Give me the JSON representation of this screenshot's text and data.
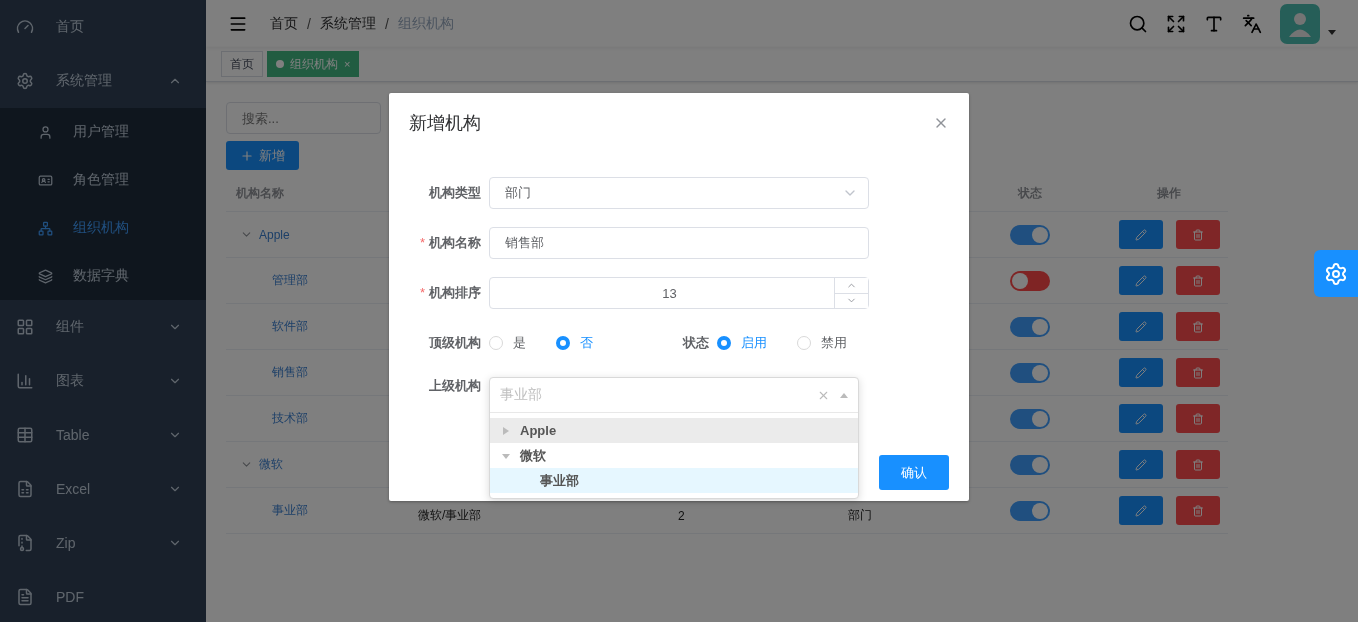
{
  "sidebar": {
    "items": [
      {
        "label": "首页"
      },
      {
        "label": "系统管理",
        "expanded": true,
        "children": [
          {
            "label": "用户管理",
            "selected": false
          },
          {
            "label": "角色管理",
            "selected": false
          },
          {
            "label": "组织机构",
            "selected": true
          },
          {
            "label": "数据字典",
            "selected": false
          }
        ]
      },
      {
        "label": "组件",
        "expanded": false
      },
      {
        "label": "图表",
        "expanded": false
      },
      {
        "label": "Table",
        "expanded": false
      },
      {
        "label": "Excel",
        "expanded": false
      },
      {
        "label": "Zip",
        "expanded": false
      },
      {
        "label": "PDF"
      }
    ]
  },
  "breadcrumb": {
    "separator": "/",
    "items": [
      "首页",
      "系统管理",
      "组织机构"
    ]
  },
  "tags": [
    {
      "label": "首页",
      "selected": false
    },
    {
      "label": "组织机构",
      "selected": true,
      "close": "×"
    }
  ],
  "search": {
    "placeholder": "搜索..."
  },
  "add_button": "新增",
  "table": {
    "columns": [
      "机构名称",
      "状态",
      "操作"
    ],
    "rows": [
      {
        "name": "Apple",
        "expanded": true,
        "on": true,
        "children": [
          {
            "name": "管理部",
            "on": false
          },
          {
            "name": "软件部",
            "on": true
          },
          {
            "name": "销售部",
            "on": true
          },
          {
            "name": "技术部",
            "on": true
          }
        ]
      },
      {
        "name": "微软",
        "expanded": true,
        "on": true,
        "children": [
          {
            "name": "事业部",
            "on": true,
            "column_2": "微软/事业部",
            "column_3": "2",
            "column_4": "部门"
          }
        ]
      }
    ]
  },
  "dialog": {
    "title": "新增机构",
    "fields": [
      {
        "kind": "select",
        "label": "机构类型",
        "value": "部门"
      },
      {
        "kind": "text",
        "label": "机构名称",
        "required_mark": "*",
        "value": "销售部"
      },
      {
        "kind": "number",
        "label": "机构排序",
        "required_mark": "*",
        "value": "13"
      },
      {
        "kind": "radios",
        "groups": [
          {
            "label": "顶级机构",
            "options": [
              {
                "label": "是",
                "selected": false
              },
              {
                "label": "否",
                "selected": true
              }
            ]
          },
          {
            "label": "状态",
            "options": [
              {
                "label": "启用",
                "selected": true
              },
              {
                "label": "禁用",
                "selected": false
              }
            ]
          }
        ]
      },
      {
        "kind": "tree_select",
        "label": "上级机构",
        "placeholder": "事业部",
        "options": [
          {
            "label": "Apple",
            "expanded": false,
            "hovered": true,
            "selected": false
          },
          {
            "label": "微软",
            "expanded": true,
            "hovered": false,
            "selected": false,
            "children": [
              {
                "label": "事业部",
                "selected": true
              }
            ]
          }
        ]
      }
    ],
    "confirm": "确认"
  }
}
